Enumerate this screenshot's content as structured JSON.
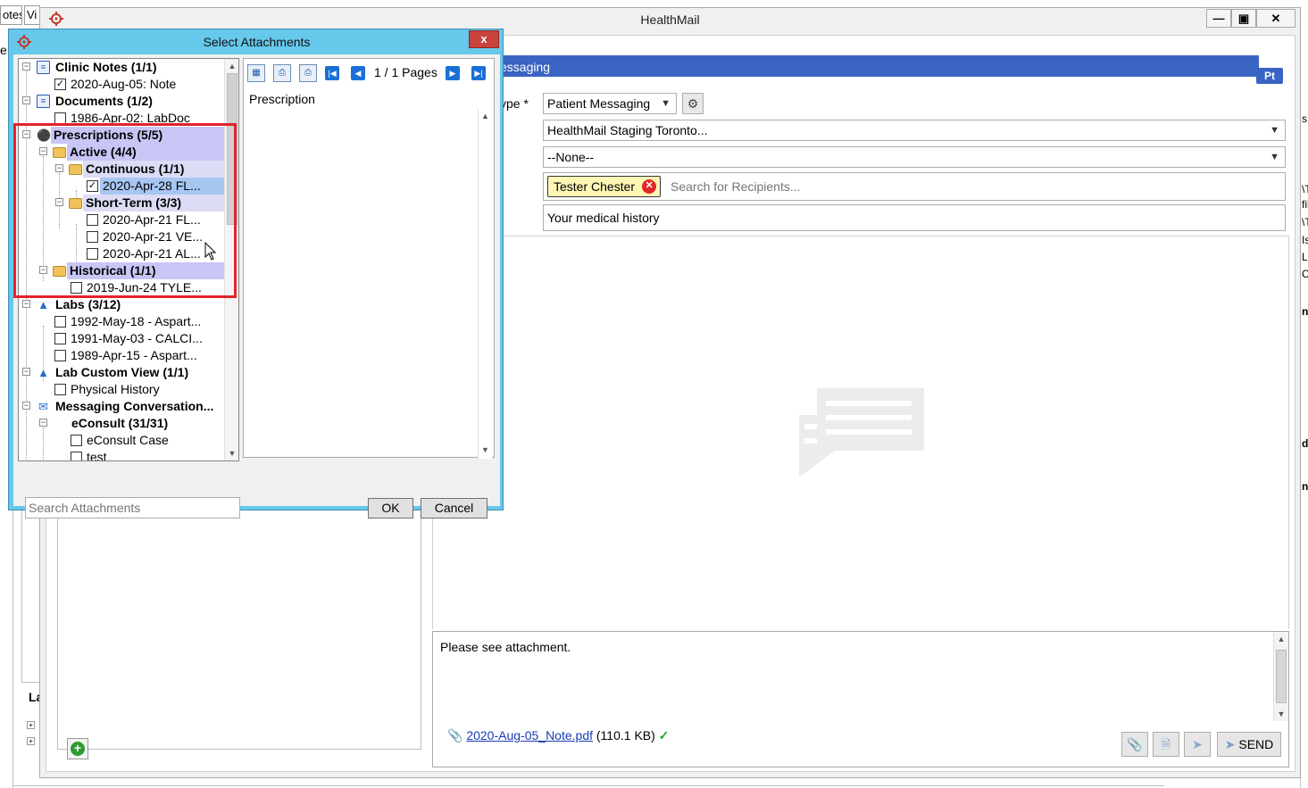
{
  "background_tabs": [
    "otes",
    "Vi"
  ],
  "background_label_e": "e",
  "background_label_la": "La",
  "window": {
    "title": "HealthMail",
    "minimize_glyph": "—",
    "maximize_glyph": "▣",
    "close_glyph": "✕"
  },
  "compose": {
    "header_label": "essaging",
    "pt_badge": "Pt",
    "type_label": "ype *",
    "type_value": "Patient Messaging",
    "from_value": "HealthMail Staging Toronto...",
    "second_value": "--None--",
    "recipient_chip": "Tester Chester",
    "recipient_placeholder": "Search for Recipients...",
    "subject": "Your medical history",
    "body": "Please see attachment.",
    "attachment_name": "2020-Aug-05_Note.pdf",
    "attachment_size": "(110.1 KB)",
    "send_label": "SEND"
  },
  "right_edge_fragments": [
    "s",
    "\\T",
    "fil",
    "\\T",
    "Is",
    "LI",
    "C",
    "n",
    "d",
    "na"
  ],
  "dialog": {
    "title": "Select Attachments",
    "close_glyph": "x",
    "tree": [
      {
        "label": "Clinic Notes (1/1)"
      },
      {
        "label": "2020-Aug-05: Note",
        "checked": true
      },
      {
        "label": "Documents (1/2)"
      },
      {
        "label": "1986-Apr-02: LabDoc",
        "checked": false
      },
      {
        "label": "Prescriptions (5/5)"
      },
      {
        "label": "Active (4/4)"
      },
      {
        "label": "Continuous (1/1)"
      },
      {
        "label": "2020-Apr-28 FL...",
        "checked": true
      },
      {
        "label": "Short-Term (3/3)"
      },
      {
        "label": "2020-Apr-21 FL...",
        "checked": false
      },
      {
        "label": "2020-Apr-21 VE...",
        "checked": false
      },
      {
        "label": "2020-Apr-21 AL...",
        "checked": false
      },
      {
        "label": "Historical (1/1)"
      },
      {
        "label": "2019-Jun-24 TYLE...",
        "checked": false
      },
      {
        "label": "Labs (3/12)"
      },
      {
        "label": "1992-May-18 - Aspart...",
        "checked": false
      },
      {
        "label": "1991-May-03 - CALCI...",
        "checked": false
      },
      {
        "label": "1989-Apr-15 - Aspart...",
        "checked": false
      },
      {
        "label": "Lab Custom View (1/1)"
      },
      {
        "label": "Physical History",
        "checked": false
      },
      {
        "label": "Messaging Conversation..."
      },
      {
        "label": "eConsult (31/31)"
      },
      {
        "label": "eConsult Case",
        "checked": false
      },
      {
        "label": "test",
        "checked": false
      }
    ],
    "preview": {
      "pages": "1 / 1 Pages",
      "label": "Prescription"
    },
    "search_placeholder": "Search Attachments",
    "ok_label": "OK",
    "cancel_label": "Cancel"
  }
}
